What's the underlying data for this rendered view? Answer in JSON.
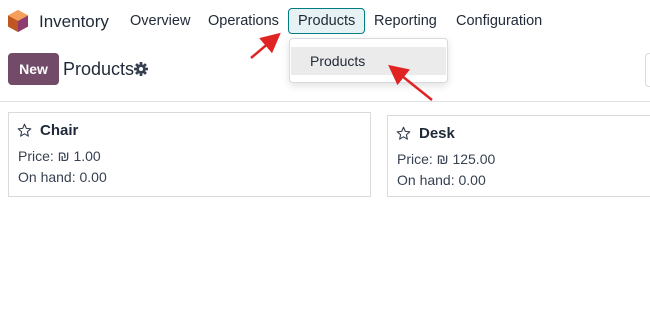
{
  "navbar": {
    "app_name": "Inventory",
    "menu": {
      "overview": "Overview",
      "operations": "Operations",
      "products": "Products",
      "reporting": "Reporting",
      "configuration": "Configuration"
    },
    "active_menu": "Products"
  },
  "dropdown": {
    "items": [
      "Products"
    ]
  },
  "control_panel": {
    "new_label": "New",
    "title": "Products"
  },
  "kanban": {
    "cards": [
      {
        "name": "Chair",
        "price": "Price: ₪ 1.00",
        "on_hand": "On hand: 0.00"
      },
      {
        "name": "Desk",
        "price": "Price: ₪ 125.00",
        "on_hand": "On hand: 0.00"
      }
    ]
  },
  "colors": {
    "brand": "#714b67",
    "active_menu_border": "#017e84",
    "annotation_arrow": "#e02424"
  },
  "icons": {
    "logo": "inventory-app-logo",
    "settings": "gear-icon",
    "favorite": "star-icon"
  }
}
